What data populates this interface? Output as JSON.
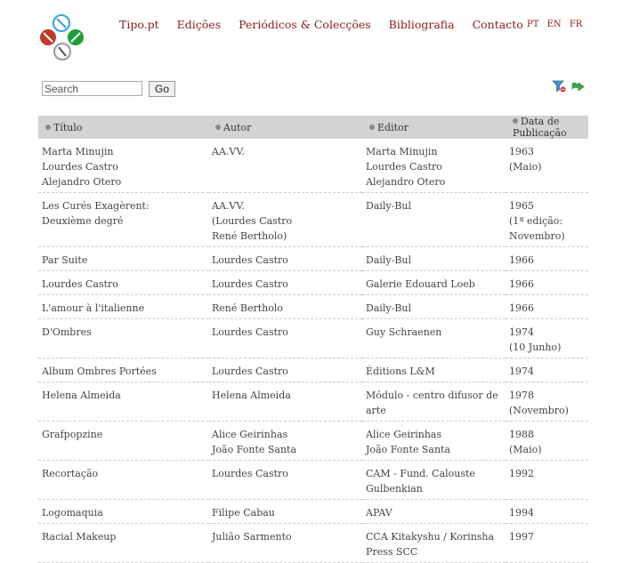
{
  "nav": {
    "items": [
      "Tipo.pt",
      "Edições",
      "Periódicos & Colecções",
      "Bibliografia",
      "Contacto"
    ],
    "languages": [
      "PT",
      "EN",
      "FR"
    ]
  },
  "search": {
    "placeholder": "Search",
    "button": "Go"
  },
  "table": {
    "headers": [
      "Título",
      "Autor",
      "Editor",
      "Data de Publicação"
    ],
    "rows": [
      [
        [
          "Marta Minujin",
          "Lourdes Castro",
          "Alejandro Otero"
        ],
        [
          "AA.VV."
        ],
        [
          "Marta Minujin",
          "Lourdes Castro",
          "Alejandro Otero"
        ],
        [
          "1963",
          "(Maio)"
        ]
      ],
      [
        [
          "Les Curés Exagèrent:",
          "Deuxième degré"
        ],
        [
          "AA.VV.",
          "(Lourdes Castro",
          "René Bertholo)"
        ],
        [
          "Daily-Bul"
        ],
        [
          "1965",
          "(1ª edição: Novembro)"
        ]
      ],
      [
        [
          "Par Suite"
        ],
        [
          "Lourdes Castro"
        ],
        [
          "Daily-Bul"
        ],
        [
          "1966"
        ]
      ],
      [
        [
          "Lourdes Castro"
        ],
        [
          "Lourdes Castro"
        ],
        [
          "Galerie Edouard Loeb"
        ],
        [
          "1966"
        ]
      ],
      [
        [
          "L'amour à l'italienne"
        ],
        [
          "René Bertholo"
        ],
        [
          "Daily-Bul"
        ],
        [
          "1966"
        ]
      ],
      [
        [
          "D'Ombres"
        ],
        [
          "Lourdes Castro"
        ],
        [
          "Guy Schraenen"
        ],
        [
          "1974",
          "(10 Junho)"
        ]
      ],
      [
        [
          "Album Ombres Portées"
        ],
        [
          "Lourdes Castro"
        ],
        [
          "Éditions L&M"
        ],
        [
          "1974"
        ]
      ],
      [
        [
          "Helena Almeida"
        ],
        [
          "Helena Almeida"
        ],
        [
          "Módulo - centro difusor de arte"
        ],
        [
          "1978",
          "(Novembro)"
        ]
      ],
      [
        [
          "Grafpopzine"
        ],
        [
          "Alice Geirinhas",
          "João Fonte Santa"
        ],
        [
          "Alice Geirinhas",
          "João Fonte Santa"
        ],
        [
          "1988",
          "(Maio)"
        ]
      ],
      [
        [
          "Recortação"
        ],
        [
          "Lourdes Castro"
        ],
        [
          "CAM - Fund. Calouste",
          "Gulbenkian"
        ],
        [
          "1992"
        ]
      ],
      [
        [
          "Logomaquia"
        ],
        [
          "Filipe Cabau"
        ],
        [
          "APAV"
        ],
        [
          "1994"
        ]
      ],
      [
        [
          "Racial Makeup"
        ],
        [
          "Julião Sarmento"
        ],
        [
          "CCA Kitakyshu / Korinsha",
          "Press SCC"
        ],
        [
          "1997"
        ]
      ]
    ]
  },
  "colors": {
    "accent": "#8b1a1a",
    "header_bg": "#d3d3d3"
  },
  "icons": {
    "logo": "tipo-logo",
    "tool1": "filter-icon",
    "tool2": "export-icon"
  }
}
